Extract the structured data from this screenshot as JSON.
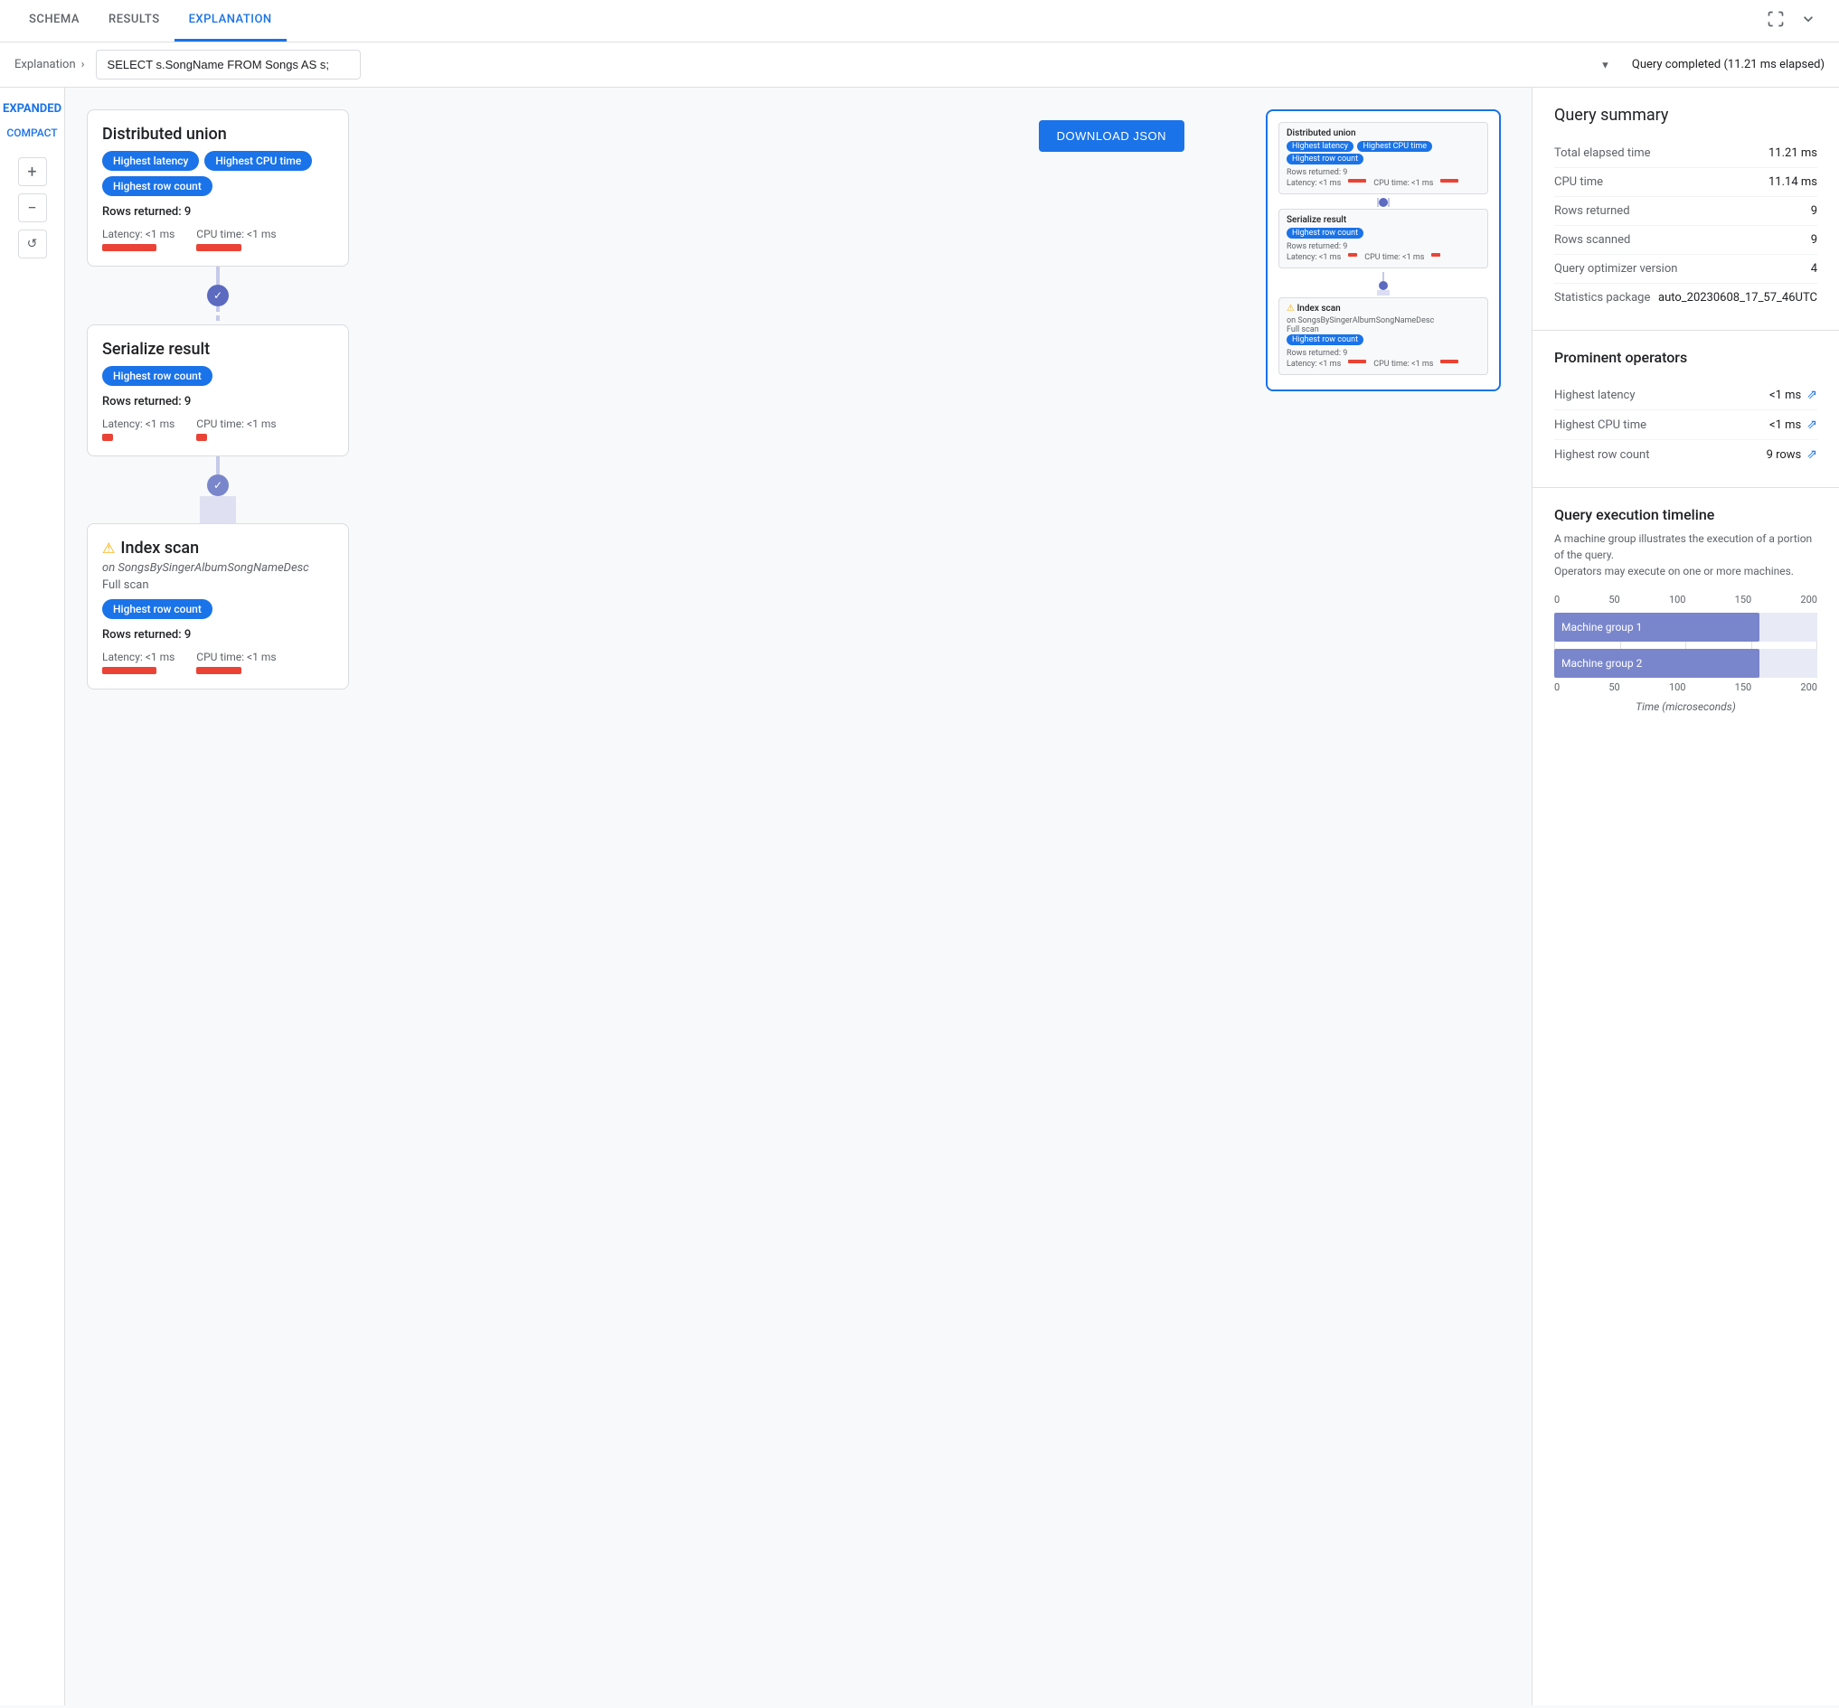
{
  "tabs": [
    {
      "label": "SCHEMA",
      "active": false
    },
    {
      "label": "RESULTS",
      "active": false
    },
    {
      "label": "EXPLANATION",
      "active": true
    }
  ],
  "breadcrumb": "Explanation",
  "query": "SELECT s.SongName FROM Songs AS s;",
  "query_status": "Query completed (11.21 ms elapsed)",
  "download_btn": "DOWNLOAD JSON",
  "views": {
    "expanded": "EXPANDED",
    "compact": "COMPACT"
  },
  "nodes": [
    {
      "id": "distributed-union",
      "title": "Distributed union",
      "badges": [
        "Highest latency",
        "Highest CPU time",
        "Highest row count"
      ],
      "rows": "Rows returned: 9",
      "latency_label": "Latency: <1 ms",
      "cpu_label": "CPU time: <1 ms"
    },
    {
      "id": "serialize-result",
      "title": "Serialize result",
      "badges": [
        "Highest row count"
      ],
      "rows": "Rows returned: 9",
      "latency_label": "Latency: <1 ms",
      "cpu_label": "CPU time: <1 ms"
    },
    {
      "id": "index-scan",
      "title": "Index scan",
      "warning": true,
      "index_on": "on SongsBySingerAlbumSongNameDesc",
      "scan_type": "Full scan",
      "badges": [
        "Highest row count"
      ],
      "rows": "Rows returned: 9",
      "latency_label": "Latency: <1 ms",
      "cpu_label": "CPU time: <1 ms"
    }
  ],
  "query_summary": {
    "title": "Query summary",
    "rows": [
      {
        "key": "Total elapsed time",
        "val": "11.21 ms"
      },
      {
        "key": "CPU time",
        "val": "11.14 ms"
      },
      {
        "key": "Rows returned",
        "val": "9"
      },
      {
        "key": "Rows scanned",
        "val": "9"
      },
      {
        "key": "Query optimizer version",
        "val": "4"
      },
      {
        "key": "Statistics package",
        "val": "auto_20230608_17_57_46UTC"
      }
    ]
  },
  "prominent_operators": {
    "title": "Prominent operators",
    "rows": [
      {
        "key": "Highest latency",
        "val": "<1 ms"
      },
      {
        "key": "Highest CPU time",
        "val": "<1 ms"
      },
      {
        "key": "Highest row count",
        "val": "9 rows"
      }
    ]
  },
  "timeline": {
    "title": "Query execution timeline",
    "desc1": "A machine group illustrates the execution of a portion of the query.",
    "desc2": "Operators may execute on one or more machines.",
    "x_axis": [
      0,
      50,
      100,
      150,
      200
    ],
    "bars": [
      {
        "label": "Machine group 1",
        "fill_pct": 78
      },
      {
        "label": "Machine group 2",
        "fill_pct": 78
      }
    ],
    "x_label": "Time (microseconds)"
  }
}
